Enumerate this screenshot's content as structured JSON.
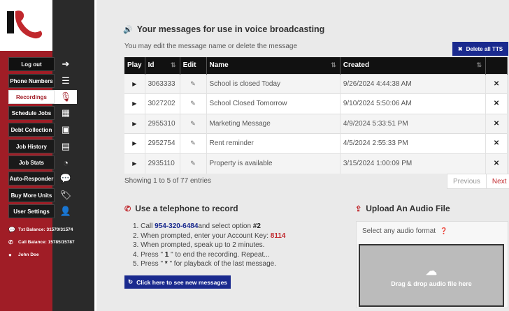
{
  "sidebar": {
    "nav": [
      {
        "label": "Log out",
        "icon": "sign-out-icon"
      },
      {
        "label": "Phone Numbers",
        "icon": "list-icon"
      },
      {
        "label": "Recordings",
        "icon": "microphone-icon"
      },
      {
        "label": "Schedule Jobs",
        "icon": "calendar-icon"
      },
      {
        "label": "Debt Collection",
        "icon": "money-icon"
      },
      {
        "label": "Job History",
        "icon": "document-icon"
      },
      {
        "label": "Job Stats",
        "icon": "pie-chart-icon"
      },
      {
        "label": "Auto-Responder",
        "icon": "chat-icon"
      },
      {
        "label": "Buy More Units",
        "icon": "tags-icon"
      },
      {
        "label": "User Settings",
        "icon": "user-icon"
      }
    ],
    "active": "Recordings",
    "txt_balance": "Txt Balance: 31570/31574",
    "call_balance": "Call Balance: 15785/15787",
    "user_name": "John Doe"
  },
  "main": {
    "title": "Your messages for use in voice broadcasting",
    "subtitle": "You may edit the message name or delete the message",
    "delete_tts_label": "Delete all TTS",
    "table": {
      "headers": [
        "Play",
        "Id",
        "Edit",
        "Name",
        "Created"
      ],
      "rows": [
        {
          "id": "3063333",
          "name": "School is closed Today",
          "created": "9/26/2024 4:44:38 AM"
        },
        {
          "id": "3027202",
          "name": "School Closed Tomorrow",
          "created": "9/10/2024 5:50:06 AM"
        },
        {
          "id": "2955310",
          "name": "Marketing Message",
          "created": "4/9/2024 5:33:51 PM"
        },
        {
          "id": "2952754",
          "name": "Rent reminder",
          "created": "4/5/2024 2:55:33 PM"
        },
        {
          "id": "2935110",
          "name": "Property is available",
          "created": "3/15/2024 1:00:09 PM"
        }
      ]
    },
    "entries_text": "Showing 1 to 5 of 77 entries",
    "pager": {
      "prev": "Previous",
      "next": "Next"
    }
  },
  "record": {
    "title": "Use a telephone to record",
    "step1_a": "1. Call ",
    "phone": "954-320-6484",
    "step1_b": "and select option ",
    "option": "#2",
    "step2_a": "2. When prompted, enter your Account Key: ",
    "account_key": "8114",
    "step3": "3. When prompted, speak up to 2 minutes.",
    "step4_a": "4. Press \" ",
    "step4_key": "1",
    "step4_b": " \" to end the recording. Repeat...",
    "step5_a": "5. Press \" ",
    "step5_key": "*",
    "step5_b": " \" for playback of the last message.",
    "see_messages_label": "Click here to see new messages"
  },
  "upload": {
    "title": "Upload An Audio File",
    "format_label": "Select any audio format",
    "dropzone_label": "Drag & drop audio file here"
  },
  "colors": {
    "brand_red": "#a01d26",
    "accent_blue": "#1a2a8e",
    "dark": "#111111"
  }
}
